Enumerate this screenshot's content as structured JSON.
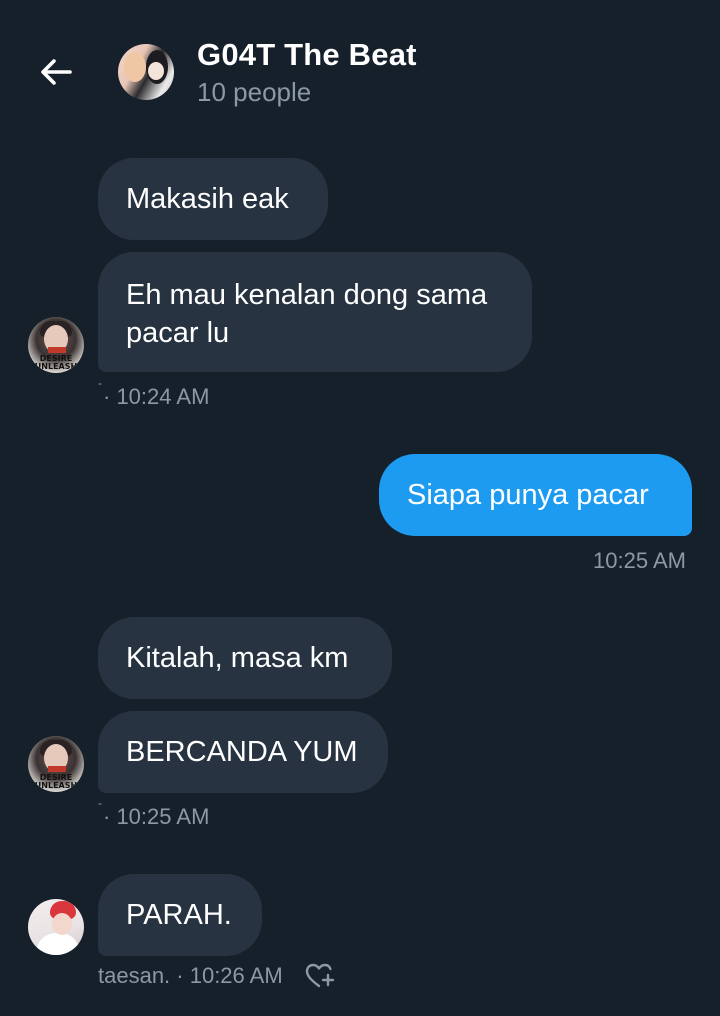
{
  "header": {
    "title": "G04T The Beat",
    "subtitle": "10 people"
  },
  "messages": [
    {
      "text": "Makasih eak"
    },
    {
      "text": "Eh mau kenalan dong sama",
      "text2": "pacar lu"
    },
    {
      "meta": "· 10:24 AM"
    },
    {
      "text": "Siapa punya pacar",
      "meta": "10:25 AM"
    },
    {
      "text": "Kitalah, masa km"
    },
    {
      "text": "BERCANDA YUM",
      "meta": "· 10:25 AM"
    },
    {
      "text": "PARAH.",
      "meta": "taesan. · 10:26 AM"
    }
  ],
  "avatar_text": {
    "line1": "DESIRE",
    "line2": "UNLEASH"
  },
  "icons": {
    "back": "arrow-left-icon",
    "react": "heart-plus-icon"
  },
  "colors": {
    "background": "#15202b",
    "bubble_other": "#273340",
    "bubble_mine": "#1d9bf0",
    "meta_text": "#8b98a5"
  }
}
